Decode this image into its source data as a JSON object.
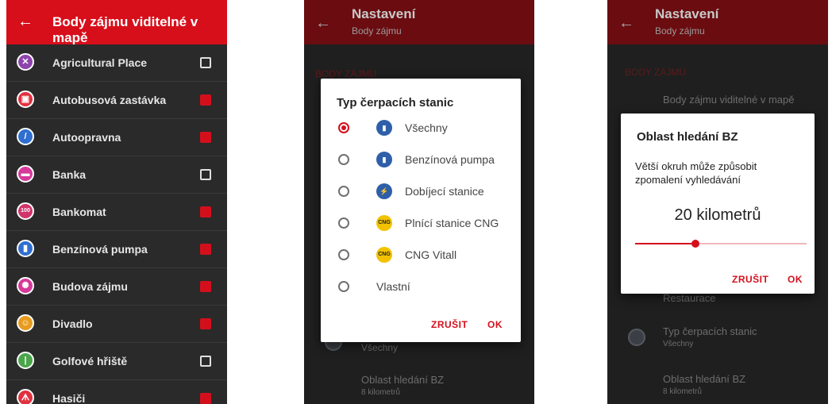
{
  "screen1": {
    "back_glyph": "←",
    "title": "Body zájmu viditelné v mapě",
    "items": [
      {
        "label": "Agricultural Place",
        "checked": false,
        "icon": "windmill-icon",
        "color": "#8e44ad",
        "glyph": "✕"
      },
      {
        "label": "Autobusová zastávka",
        "checked": true,
        "icon": "bus-icon",
        "color": "#e0313f",
        "glyph": "▣"
      },
      {
        "label": "Autoopravna",
        "checked": true,
        "icon": "wrench-icon",
        "color": "#2f6fd0",
        "glyph": "/"
      },
      {
        "label": "Banka",
        "checked": false,
        "icon": "bank-icon",
        "color": "#d63a9a",
        "glyph": "▬"
      },
      {
        "label": "Bankomat",
        "checked": true,
        "icon": "atm-icon",
        "color": "#d0346a",
        "glyph": "100"
      },
      {
        "label": "Benzínová pumpa",
        "checked": true,
        "icon": "fuel-pump-icon",
        "color": "#2f6fd0",
        "glyph": "▮"
      },
      {
        "label": "Budova zájmu",
        "checked": true,
        "icon": "building-icon",
        "color": "#d63a9a",
        "glyph": "✺"
      },
      {
        "label": "Divadlo",
        "checked": true,
        "icon": "theater-icon",
        "color": "#e89b1e",
        "glyph": "☺"
      },
      {
        "label": "Golfové hřiště",
        "checked": false,
        "icon": "golf-icon",
        "color": "#4aa64a",
        "glyph": "|"
      },
      {
        "label": "Hasiči",
        "checked": true,
        "icon": "fire-station-icon",
        "color": "#e0313f",
        "glyph": "ᗑ"
      }
    ]
  },
  "screen2": {
    "back_glyph": "←",
    "title": "Nastavení",
    "subtitle": "Body zájmu",
    "bg_section": "BODY ZÁJMU",
    "bg_item_sub": "Všechny",
    "bg_item2_title": "Oblast hledání BZ",
    "bg_item2_sub": "8 kilometrů",
    "dialog": {
      "title": "Typ čerpacích stanic",
      "options": [
        {
          "label": "Všechny",
          "selected": true,
          "icon": "fuel-pump-icon",
          "badge": "▮"
        },
        {
          "label": "Benzínová pumpa",
          "selected": false,
          "icon": "fuel-pump-icon",
          "badge": "▮"
        },
        {
          "label": "Dobíjecí stanice",
          "selected": false,
          "icon": "charging-station-icon",
          "badge": "⚡"
        },
        {
          "label": "Plnící stanice CNG",
          "selected": false,
          "icon": "cng-icon",
          "badge": "CNG"
        },
        {
          "label": "CNG Vitall",
          "selected": false,
          "icon": "cng-icon",
          "badge": "CNG"
        },
        {
          "label": "Vlastní",
          "selected": false,
          "icon": "",
          "badge": ""
        }
      ],
      "cancel": "ZRUŠIT",
      "ok": "OK"
    }
  },
  "screen3": {
    "back_glyph": "←",
    "title": "Nastavení",
    "subtitle": "Body zájmu",
    "bg_section": "BODY ZÁJMU",
    "bg_item1": "Body zájmu viditelné v mapě",
    "bg_item2": "Restaurace",
    "bg_item3_title": "Typ čerpacích stanic",
    "bg_item3_sub": "Všechny",
    "bg_item4_title": "Oblast hledání BZ",
    "bg_item4_sub": "8 kilometrů",
    "dialog": {
      "title": "Oblast hledání BZ",
      "message": "Větší okruh může způsobit zpomalení vyhledávání",
      "value_label": "20 kilometrů",
      "slider_fraction": 0.35,
      "cancel": "ZRUŠIT",
      "ok": "OK"
    }
  },
  "colors": {
    "accent": "#d40f1c",
    "appbar": "#d70f1b",
    "appbar_dim": "#6a0c10",
    "list_bg": "#2a2a2a"
  }
}
